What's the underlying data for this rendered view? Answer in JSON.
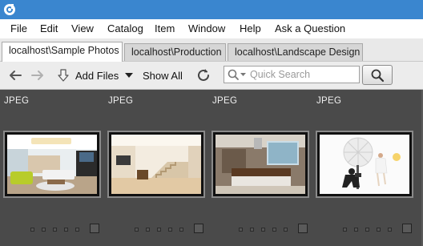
{
  "window": {
    "title_bar_color": "#3a86cf"
  },
  "menu": {
    "items": [
      "File",
      "Edit",
      "View",
      "Catalog",
      "Item",
      "Window",
      "Help",
      "Ask a Question"
    ]
  },
  "tabs": [
    {
      "label": "localhost\\Sample Photos",
      "active": true
    },
    {
      "label": "localhost\\Production",
      "active": false
    },
    {
      "label": "localhost\\Landscape Design",
      "active": false
    }
  ],
  "toolbar": {
    "back_icon": "arrow-left-icon",
    "forward_icon": "arrow-right-icon",
    "add_files_label": "Add Files",
    "show_all_label": "Show All",
    "refresh_icon": "refresh-icon",
    "search_placeholder": "Quick Search",
    "search_button_icon": "magnifier-icon"
  },
  "items": [
    {
      "type": "JPEG",
      "thumbnail": "living-room-photo"
    },
    {
      "type": "JPEG",
      "thumbnail": "staircase-interior-photo"
    },
    {
      "type": "JPEG",
      "thumbnail": "kitchen-photo"
    },
    {
      "type": "JPEG",
      "thumbnail": "photographer-studio-photo"
    }
  ],
  "colors": {
    "grid_background": "#4a4a4a",
    "accent": "#3a86cf"
  }
}
